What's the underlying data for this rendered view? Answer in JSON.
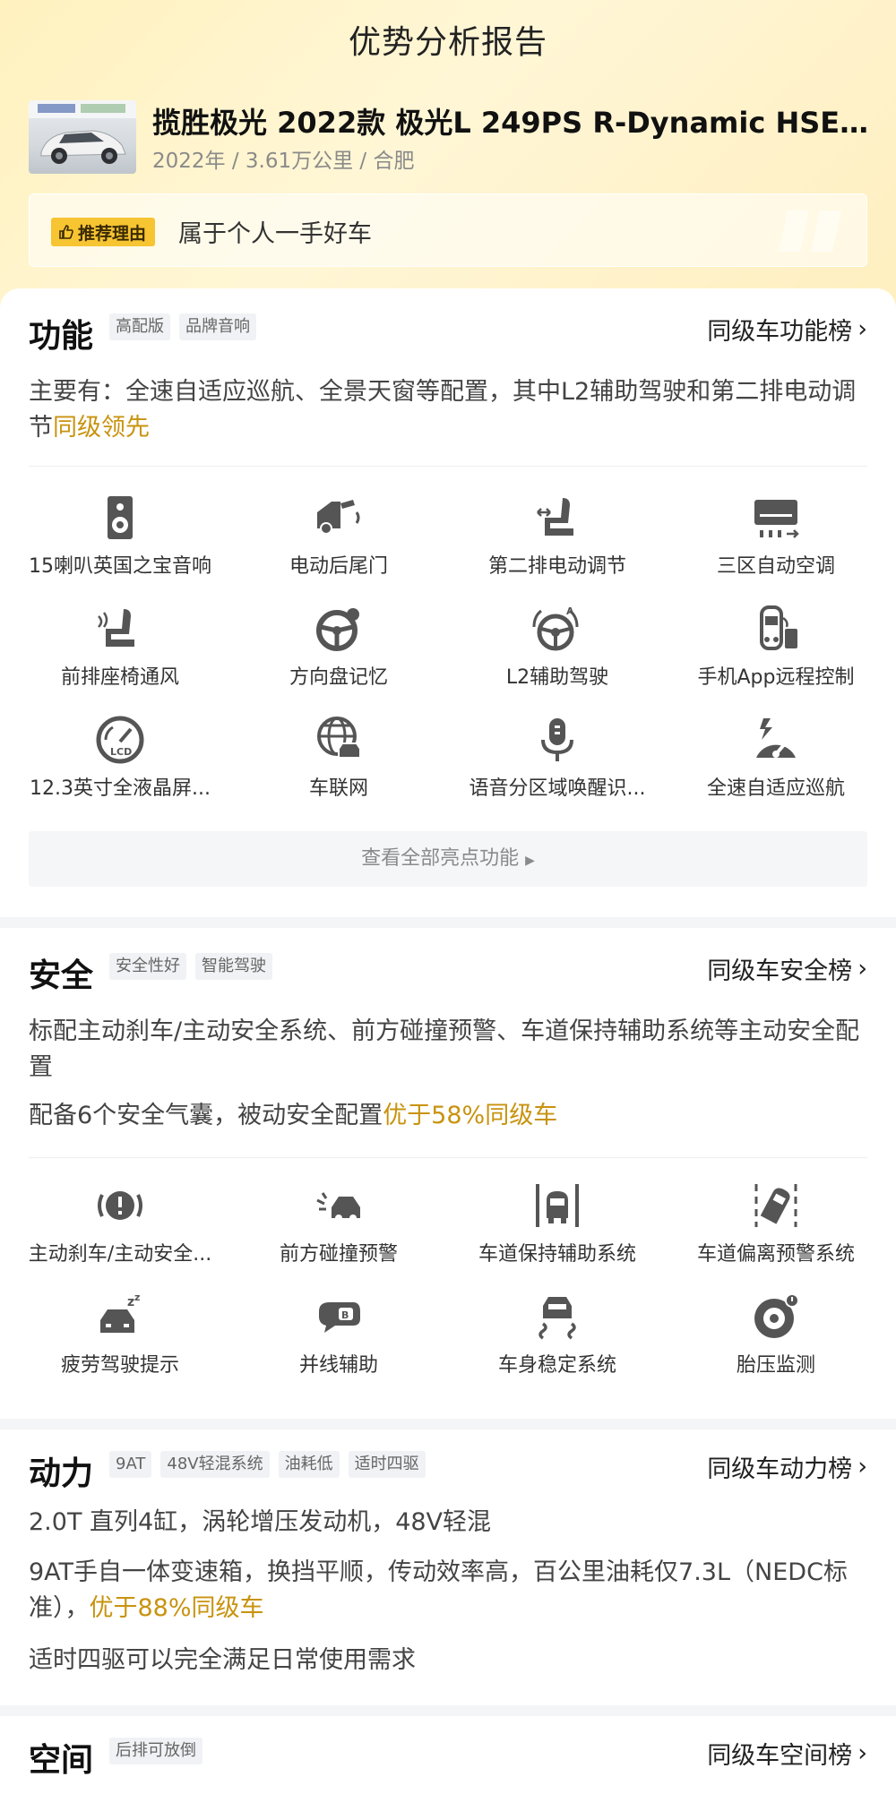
{
  "page_title": "优势分析报告",
  "car": {
    "name": "揽胜极光 2022款 极光L 249PS R-Dynamic HSE ...",
    "meta": "2022年 / 3.61万公里 / 合肥"
  },
  "reason": {
    "badge": "推荐理由",
    "text": "属于个人一手好车"
  },
  "sections": {
    "function": {
      "title": "功能",
      "tags": [
        "高配版",
        "品牌音响"
      ],
      "rank_link": "同级车功能榜",
      "desc_main": "主要有：全速自适应巡航、全景天窗等配置，其中L2辅助驾驶和第二排电动调节",
      "desc_hl": "同级领先",
      "features": [
        {
          "label": "15喇叭英国之宝音响",
          "icon": "speaker-icon"
        },
        {
          "label": "电动后尾门",
          "icon": "power-tailgate-icon"
        },
        {
          "label": "第二排电动调节",
          "icon": "seat-adjust-icon"
        },
        {
          "label": "三区自动空调",
          "icon": "air-conditioner-icon"
        },
        {
          "label": "前排座椅通风",
          "icon": "seat-ventilation-icon"
        },
        {
          "label": "方向盘记忆",
          "icon": "steering-memory-icon"
        },
        {
          "label": "L2辅助驾驶",
          "icon": "assisted-driving-icon"
        },
        {
          "label": "手机App远程控制",
          "icon": "phone-remote-icon"
        },
        {
          "label": "12.3英寸全液晶屏...",
          "icon": "lcd-gauge-icon"
        },
        {
          "label": "车联网",
          "icon": "connected-car-icon"
        },
        {
          "label": "语音分区域唤醒识...",
          "icon": "microphone-icon"
        },
        {
          "label": "全速自适应巡航",
          "icon": "adaptive-cruise-icon"
        }
      ],
      "view_all": "查看全部亮点功能"
    },
    "safety": {
      "title": "安全",
      "tags": [
        "安全性好",
        "智能驾驶"
      ],
      "rank_link": "同级车安全榜",
      "desc_1": "标配主动刹车/主动安全系统、前方碰撞预警、车道保持辅助系统等主动安全配置",
      "desc_2_main": "配备6个安全气囊，被动安全配置",
      "desc_2_hl": "优于58%同级车",
      "features": [
        {
          "label": "主动刹车/主动安全...",
          "icon": "active-brake-icon"
        },
        {
          "label": "前方碰撞预警",
          "icon": "collision-warning-icon"
        },
        {
          "label": "车道保持辅助系统",
          "icon": "lane-keep-icon"
        },
        {
          "label": "车道偏离预警系统",
          "icon": "lane-departure-icon"
        },
        {
          "label": "疲劳驾驶提示",
          "icon": "fatigue-alert-icon"
        },
        {
          "label": "并线辅助",
          "icon": "blind-spot-icon"
        },
        {
          "label": "车身稳定系统",
          "icon": "stability-control-icon"
        },
        {
          "label": "胎压监测",
          "icon": "tire-pressure-icon"
        }
      ]
    },
    "power": {
      "title": "动力",
      "tags": [
        "9AT",
        "48V轻混系统",
        "油耗低",
        "适时四驱"
      ],
      "rank_link": "同级车动力榜",
      "desc_1": "2.0T 直列4缸，涡轮增压发动机，48V轻混",
      "desc_2_main": "9AT手自一体变速箱，换挡平顺，传动效率高，百公里油耗仅7.3L（NEDC标准），",
      "desc_2_hl": "优于88%同级车",
      "desc_3": "适时四驱可以完全满足日常使用需求"
    },
    "space": {
      "title": "空间",
      "tags": [
        "后排可放倒"
      ],
      "rank_link": "同级车空间榜"
    }
  },
  "colors": {
    "accent": "#c8930f",
    "badge": "#f7c432",
    "icon": "#555555"
  }
}
